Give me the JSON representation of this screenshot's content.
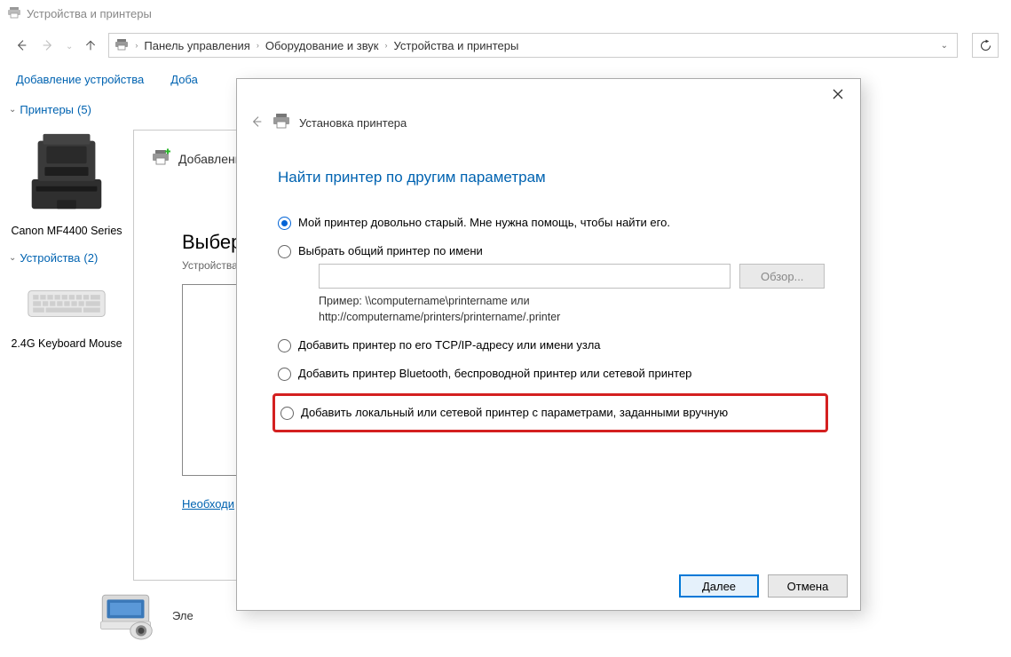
{
  "title": "Устройства и принтеры",
  "breadcrumb": {
    "segments": [
      "Панель управления",
      "Оборудование и звук",
      "Устройства и принтеры"
    ]
  },
  "cmdbar": {
    "add_device": "Добавление устройства",
    "add_printer_truncated": "Доба"
  },
  "categories": {
    "printers": {
      "label": "Принтеры",
      "count": "(5)"
    },
    "devices": {
      "label": "Устройства",
      "count": "(2)"
    }
  },
  "devices": {
    "printer1": "Canon MF4400 Series",
    "keyboard": "2.4G Keyboard Mouse"
  },
  "partial_panel": {
    "add_label": "Добавление",
    "heading": "Выбер",
    "sub": "Устройства",
    "link": "Необходи"
  },
  "statusbar": {
    "label": "Эле"
  },
  "dialog": {
    "header": "Установка принтера",
    "title": "Найти принтер по другим параметрам",
    "opt1": "Мой принтер довольно старый. Мне нужна помощь, чтобы найти его.",
    "opt2": "Выбрать общий принтер по имени",
    "opt3": "Добавить принтер по его TCP/IP-адресу или имени узла",
    "opt4": "Добавить принтер Bluetooth, беспроводной принтер или сетевой принтер",
    "opt5": "Добавить локальный или сетевой принтер с параметрами, заданными вручную",
    "browse": "Обзор...",
    "example_l1": "Пример: \\\\computername\\printername или",
    "example_l2": "http://computername/printers/printername/.printer",
    "next": "Далее",
    "cancel": "Отмена"
  }
}
